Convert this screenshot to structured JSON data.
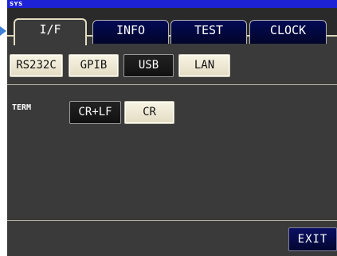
{
  "window": {
    "title": "SYS"
  },
  "tabs": [
    {
      "label": "I/F",
      "active": true
    },
    {
      "label": "INFO",
      "active": false
    },
    {
      "label": "TEST",
      "active": false
    },
    {
      "label": "CLOCK",
      "active": false
    }
  ],
  "interface": {
    "options": [
      "RS232C",
      "GPIB",
      "USB",
      "LAN"
    ],
    "selected": "USB"
  },
  "term": {
    "label": "TERM",
    "options": [
      "CR+LF",
      "CR"
    ],
    "selected": "CR+LF"
  },
  "footer": {
    "exit_label": "EXIT"
  },
  "colors": {
    "title_bar": "#1e22d6",
    "tab_bg": "#030a55",
    "button_bg": "#efe9d2",
    "selected_bg": "#111111",
    "screen_bg": "#3a3a3a"
  }
}
